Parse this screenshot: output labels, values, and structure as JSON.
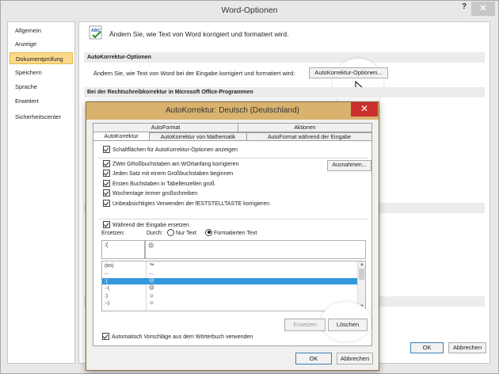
{
  "main_window": {
    "title": "Word-Optionen",
    "help_icon": "?",
    "close_icon": "✕",
    "sidebar": [
      {
        "label": "Allgemein"
      },
      {
        "label": "Anzeige"
      },
      {
        "label": "Dokumentprüfung",
        "active": true
      },
      {
        "label": "Speichern"
      },
      {
        "label": "Sprache"
      },
      {
        "label": "Erweitert"
      },
      {
        "label": "Sicherheitscenter"
      }
    ],
    "intro_text": "Ändern Sie, wie Text von Word korrigiert und formatiert wird.",
    "section_autocorrect": "AutoKorrektur-Optionen",
    "autocorrect_desc": "Ändern Sie, wie Text von Word bei der Eingabe korrigiert und formatiert wird:",
    "autocorrect_button": "AutoKorrektur-Optionen...",
    "section_spelling": "Bei der Rechtschreibkorrektur in Microsoft Office-Programmen",
    "ok_label": "OK",
    "cancel_label": "Abbrechen"
  },
  "dialog": {
    "title": "AutoKorrektur: Deutsch (Deutschland)",
    "close_icon": "✕",
    "tabs_row1": [
      "AutoFormat",
      "Aktionen"
    ],
    "tabs_row2": [
      "AutoKorrektur",
      "AutoKorrektur von Mathematik",
      "AutoFormat während der Eingabe"
    ],
    "show_buttons_option": "Schaltflächen für AutoKorrektur-Optionen anzeigen",
    "options": [
      "ZWei GRoßbuchstaben am WOrtanfang korrigieren",
      "Jeden Satz mit einem Großbuchstaben beginnen",
      "Ersten Buchstaben in Tabellenzellen groß",
      "Wochentage immer großschreiben",
      "Unbeabsichtigtes Verwenden der fESTSTELLTASTE korrigieren"
    ],
    "exceptions_button": "Ausnahmen...",
    "replace_while_typing": "Während der Eingabe ersetzen",
    "replace_label": "Ersetzen:",
    "with_label": "Durch:",
    "radio_plain": "Nur Text",
    "radio_formatted": "Formatierten Text",
    "replace_value": ":(",
    "with_value": "☹",
    "list_rows": [
      {
        "replace": "(tm)",
        "with": "™"
      },
      {
        "replace": "...",
        "with": "..."
      },
      {
        "replace": ":(",
        "with": "☹",
        "selected": true
      },
      {
        "replace": ":-(",
        "with": "☹"
      },
      {
        "replace": ":)",
        "with": "☺"
      },
      {
        "replace": ":-)",
        "with": "☺"
      }
    ],
    "replace_button": "Ersetzen",
    "delete_button": "Löschen",
    "suggestions_option": "Automatisch Vorschläge aus dem Wörterbuch verwenden",
    "ok_label": "OK",
    "cancel_label": "Abbrechen"
  }
}
